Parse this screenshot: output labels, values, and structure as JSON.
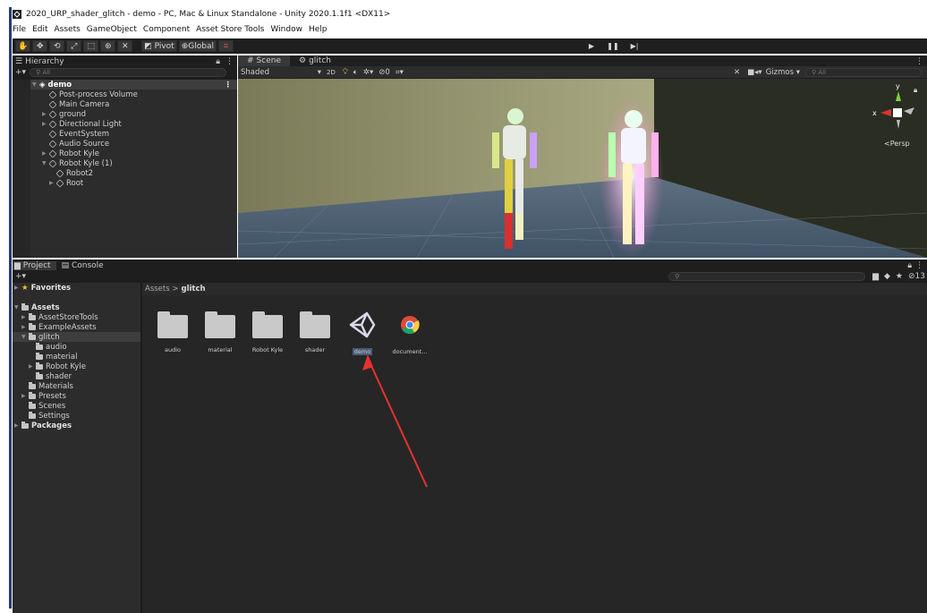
{
  "window": {
    "title": "2020_URP_shader_glitch - demo - PC, Mac & Linux Standalone - Unity 2020.1.1f1 <DX11>"
  },
  "menu": [
    "File",
    "Edit",
    "Assets",
    "GameObject",
    "Component",
    "Asset Store Tools",
    "Window",
    "Help"
  ],
  "toolbar": {
    "pivot": "Pivot",
    "global": "Global"
  },
  "hierarchy": {
    "tab": "Hierarchy",
    "search_placeholder": "All",
    "items": [
      "demo",
      "Post-process Volume",
      "Main Camera",
      "ground",
      "Directional Light",
      "EventSystem",
      "Audio Source",
      "Robot Kyle",
      "Robot Kyle (1)",
      "Robot2",
      "Root"
    ]
  },
  "scene": {
    "tabs": [
      "Scene",
      "glitch"
    ],
    "shading": "Shaded",
    "mode2d": "2D",
    "fx_count": "0",
    "gizmos": "Gizmos",
    "search_placeholder": "All",
    "persp_label": "Persp",
    "axis_y": "y",
    "axis_x": "x"
  },
  "project": {
    "tabs": [
      "Project",
      "Console"
    ],
    "hidden_count": "13",
    "favorites": "Favorites",
    "assets": "Assets",
    "tree": [
      "AssetStoreTools",
      "ExampleAssets",
      "glitch",
      "audio",
      "material",
      "Robot Kyle",
      "shader",
      "Materials",
      "Presets",
      "Scenes",
      "Settings"
    ],
    "packages": "Packages",
    "breadcrumb_root": "Assets",
    "breadcrumb_sep": ">",
    "breadcrumb_current": "glitch",
    "files": [
      "audio",
      "material",
      "Robot Kyle",
      "shader",
      "demo",
      "document..."
    ]
  },
  "colors": {
    "annotation_arrow": "#e8322c",
    "accent": "#283a7a"
  }
}
